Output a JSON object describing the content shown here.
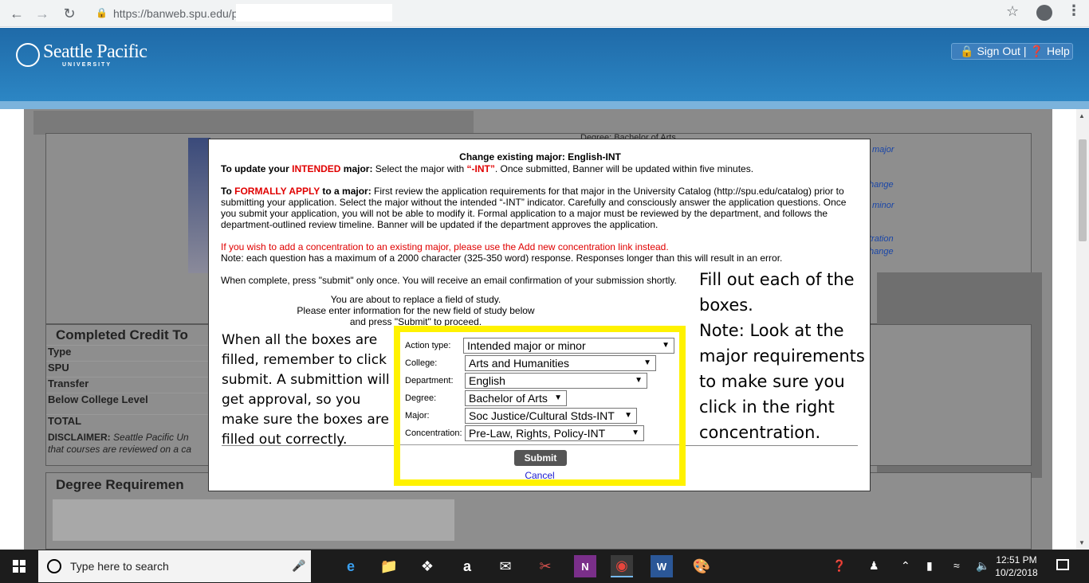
{
  "browser": {
    "url": "https://banweb.spu.edu/p"
  },
  "header": {
    "logo_name": "Seattle Pacific",
    "logo_sub": "UNIVERSITY",
    "sign_out": "Sign Out",
    "separator": "|",
    "help": "Help"
  },
  "background": {
    "degree_text": "Degree: Bachelor of Arts",
    "completed_heading": "Completed Credit To",
    "rows": [
      "Type",
      "SPU",
      "Transfer",
      "Below College Level",
      "TOTAL"
    ],
    "disclaimer_label": "DISCLAIMER:",
    "disclaimer_text": "Seattle Pacific Un",
    "disclaimer_text2": "that courses are reviewed on a ca",
    "degree_heading": "Degree Requiremen",
    "side_links": [
      "major",
      "hange",
      "minor",
      "tration",
      "hange"
    ]
  },
  "modal": {
    "title": "Change existing major: English-INT",
    "p1_lead": "To update your ",
    "p1_intended": "INTENDED",
    "p1_major": " major:",
    "p1_text": "  Select the major with ",
    "p1_int": "“-INT”",
    "p1_rest": ".  Once submitted, Banner will be updated within five minutes.",
    "p2_lead": "To ",
    "p2_formally": "FORMALLY APPLY",
    "p2_major": " to a major:",
    "p2_text": " First review the application requirements for that major in the University Catalog (http://spu.edu/catalog) prior to submitting your application.  Select the major without  the intended “-INT” indicator.  Carefully and consciously answer the application questions.  Once you submit your application, you will not be able to modify it.  Formal application to a major must be reviewed by the department, and follows the department-outlined review timeline.  Banner will be updated if the department approves the application.",
    "p3_red": "If you wish to add a concentration to an existing major, please use the Add new concentration link instead.",
    "p3_note": "Note: each question has a maximum of a 2000 character (325-350 word) response. Responses longer than this will result in an error.",
    "p4": "When complete, press \"submit\" only once.  You will receive an email confirmation of your submission shortly.",
    "replace_l1": "You are about to replace a field of study.",
    "replace_l2": "Please enter information for the new field of study below",
    "replace_l3": "and press \"Submit\" to proceed.",
    "form": {
      "action_label": "Action type:",
      "action_value": "Intended major or minor",
      "college_label": "College:",
      "college_value": "Arts and Humanities",
      "department_label": "Department:",
      "department_value": "English",
      "degree_label": "Degree:",
      "degree_value": "Bachelor of Arts",
      "major_label": "Major:",
      "major_value": "Soc Justice/Cultural Stds-INT",
      "concentration_label": "Concentration:",
      "concentration_value": "Pre-Law, Rights, Policy-INT",
      "submit": "Submit",
      "cancel": "Cancel"
    },
    "annotation_left": "When all the boxes are filled, remember to click submit. A submittion will get approval, so you make sure the boxes are filled out correctly.",
    "annotation_right_1": "Fill out each of the boxes.",
    "annotation_right_2": "Note: Look at the major requirements to make sure you click in the right concentration."
  },
  "taskbar": {
    "search_placeholder": "Type here to search",
    "time": "12:51 PM",
    "date": "10/2/2018"
  },
  "colors": {
    "header_blue": "#2c86c4",
    "highlight_yellow": "#fff200",
    "alert_red": "#e00000"
  }
}
